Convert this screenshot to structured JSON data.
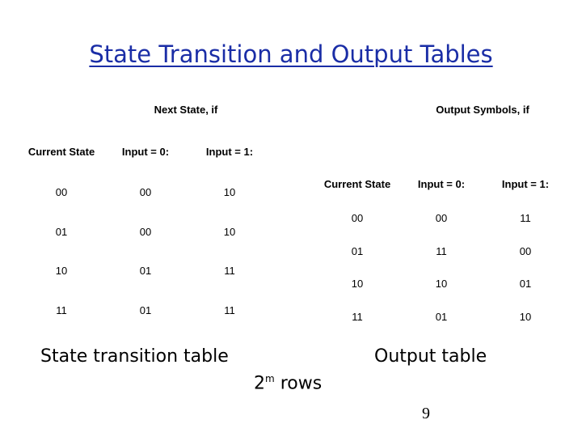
{
  "title": "State Transition and Output Tables",
  "state_table": {
    "group_header": "Next State, if",
    "columns": [
      "Current State",
      "Input = 0:",
      "Input = 1:"
    ],
    "rows": [
      [
        "00",
        "00",
        "10"
      ],
      [
        "01",
        "00",
        "10"
      ],
      [
        "10",
        "01",
        "11"
      ],
      [
        "11",
        "01",
        "11"
      ]
    ],
    "caption": "State transition table"
  },
  "output_table": {
    "group_header": "Output Symbols, if",
    "columns": [
      "Current State",
      "Input = 0:",
      "Input = 1:"
    ],
    "rows": [
      [
        "00",
        "00",
        "11"
      ],
      [
        "01",
        "11",
        "00"
      ],
      [
        "10",
        "10",
        "01"
      ],
      [
        "11",
        "01",
        "10"
      ]
    ],
    "caption": "Output table"
  },
  "rows_note": {
    "base": "2",
    "exponent": "m",
    "text": " rows"
  },
  "page_number": "9"
}
